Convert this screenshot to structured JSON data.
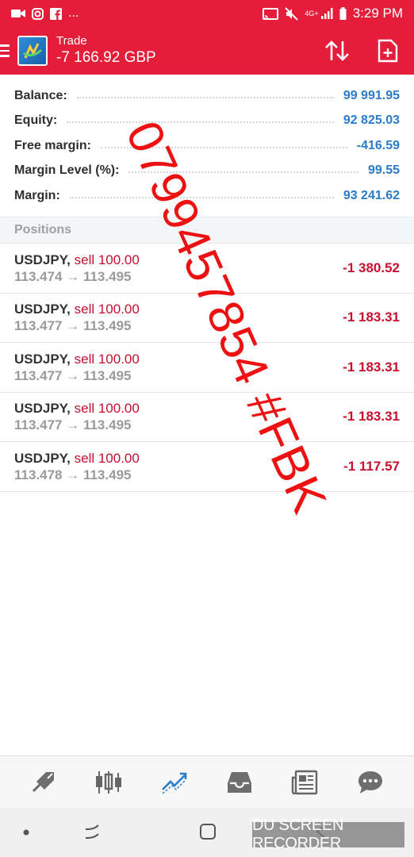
{
  "status_bar": {
    "notifications_more": "...",
    "time": "3:29 PM",
    "network_label": "4G+",
    "color": "#e41e3a"
  },
  "app_bar": {
    "title": "Trade",
    "profit": "-7 166.92 GBP",
    "color": "#e41e3a",
    "icons": [
      "menu-icon",
      "metatrader-logo",
      "sort-icon",
      "new-order-icon"
    ]
  },
  "summary": {
    "rows": [
      {
        "label": "Balance:",
        "value": "99 991.95"
      },
      {
        "label": "Equity:",
        "value": "92 825.03"
      },
      {
        "label": "Free margin:",
        "value": "-416.59"
      },
      {
        "label": "Margin Level (%):",
        "value": "99.55"
      },
      {
        "label": "Margin:",
        "value": "93 241.62"
      }
    ],
    "value_color": "#2a7bc8"
  },
  "positions": {
    "title": "Positions",
    "items": [
      {
        "symbol": "USDJPY,",
        "side": "sell 100.00",
        "prices": "113.474 → 113.495",
        "profit": "-1 380.52"
      },
      {
        "symbol": "USDJPY,",
        "side": "sell 100.00",
        "prices": "113.477 → 113.495",
        "profit": "-1 183.31"
      },
      {
        "symbol": "USDJPY,",
        "side": "sell 100.00",
        "prices": "113.477 → 113.495",
        "profit": "-1 183.31"
      },
      {
        "symbol": "USDJPY,",
        "side": "sell 100.00",
        "prices": "113.477 → 113.495",
        "profit": "-1 183.31"
      },
      {
        "symbol": "USDJPY,",
        "side": "sell 100.00",
        "prices": "113.478 → 113.495",
        "profit": "-1 117.57"
      }
    ],
    "loss_color": "#c8102e"
  },
  "watermark": {
    "text": "0799457854 #FBK",
    "color": "#ee1111"
  },
  "bottom_nav": {
    "items": [
      "quotes-icon",
      "chart-icon",
      "trade-icon",
      "history-icon",
      "news-icon",
      "messages-icon"
    ],
    "active": "trade-icon",
    "active_color": "#2a7bc8"
  },
  "recorder": {
    "label": "DU SCREEN RECORDER"
  }
}
